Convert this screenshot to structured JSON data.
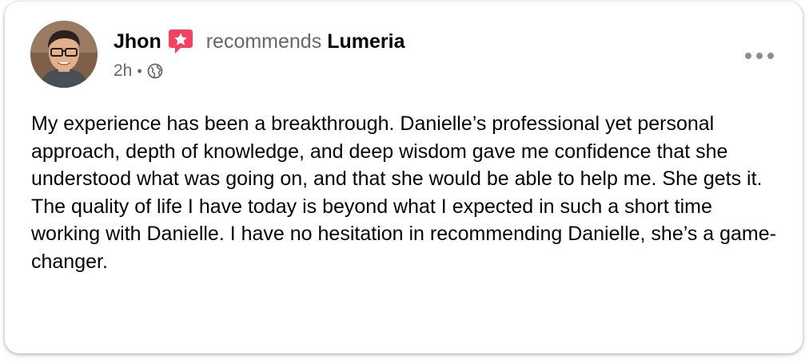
{
  "post": {
    "author": "Jhon",
    "action": "recommends",
    "page": "Lumeria",
    "time": "2h",
    "separator": "•",
    "privacy_icon": "globe-icon",
    "recommend_icon": "recommendation-badge-icon",
    "more_icon": "more-options-icon",
    "body": "My experience has been a breakthrough. Danielle’s professional yet personal approach, depth of knowledge, and deep wisdom gave me confidence that she understood what was going on, and that she would be able to help me. She gets it. The quality of life I have today is beyond what I expected in such a short time working with Danielle. I have no hesitation in recommending Danielle, she’s a game-changer."
  },
  "colors": {
    "recommend_badge": "#f3425f",
    "secondary_text": "#65676b",
    "primary_text": "#050505"
  }
}
